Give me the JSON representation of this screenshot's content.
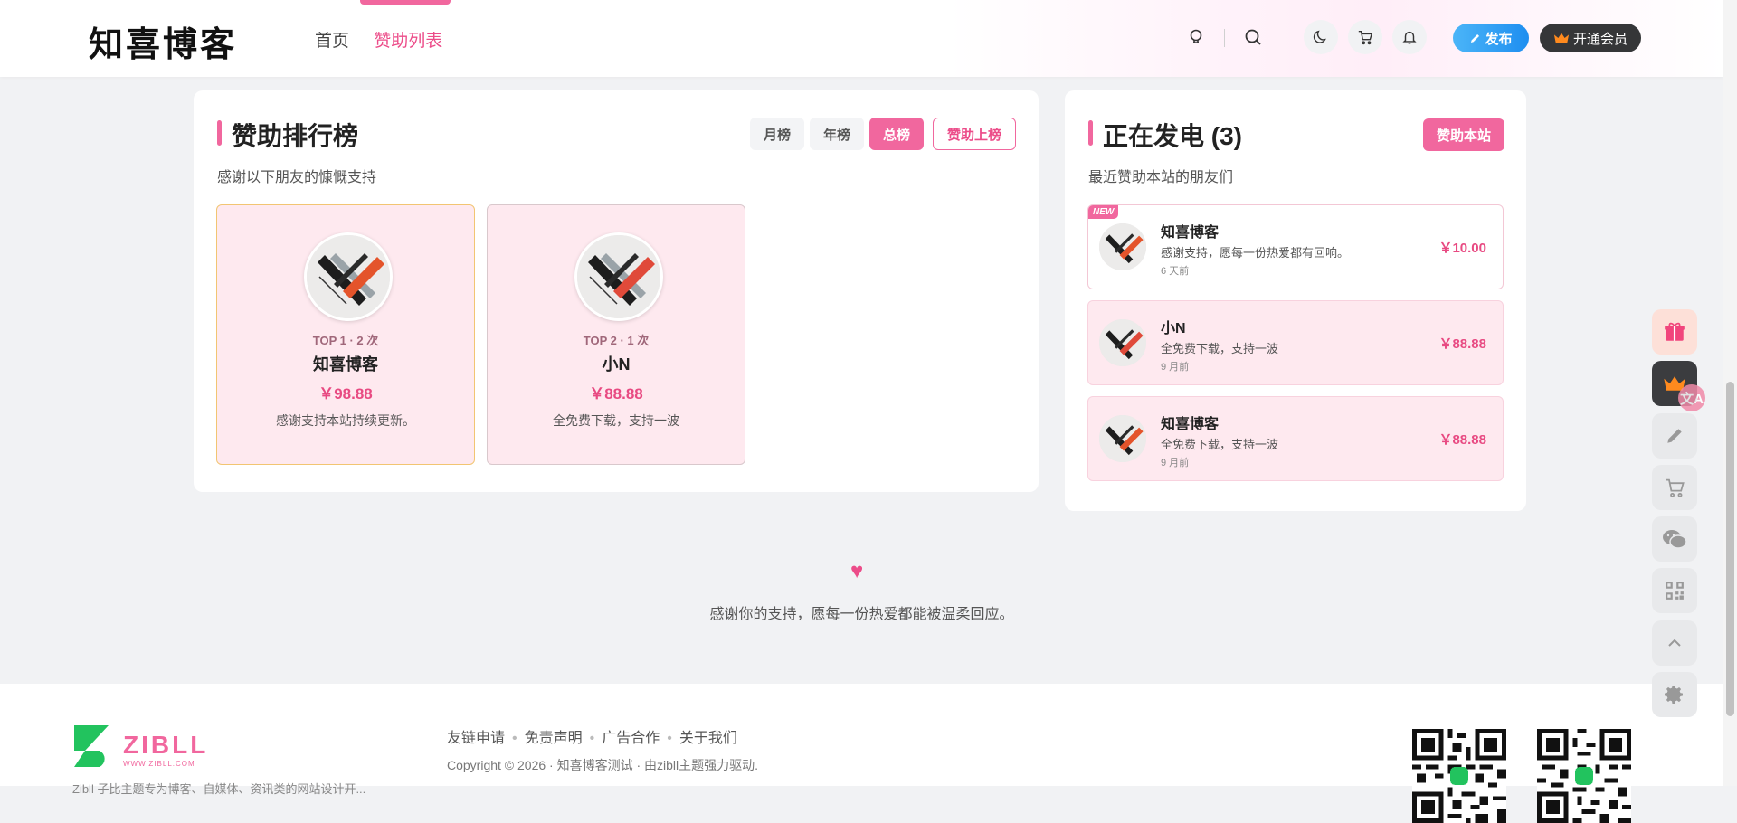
{
  "header": {
    "logo": "知喜博客",
    "nav": [
      {
        "label": "首页"
      },
      {
        "label": "赞助列表"
      }
    ],
    "publish_label": "发布",
    "vip_label": "开通会员",
    "icons": [
      "lightbulb-icon",
      "search-icon",
      "moon-icon",
      "cart-icon",
      "bell-icon"
    ]
  },
  "ranking": {
    "title": "赞助排行榜",
    "subtitle": "感谢以下朋友的慷慨支持",
    "tabs": [
      {
        "label": "月榜"
      },
      {
        "label": "年榜"
      },
      {
        "label": "总榜"
      }
    ],
    "active_tab": "总榜",
    "upload_label": "赞助上榜",
    "items": [
      {
        "rank": "TOP 1 · 2 次",
        "name": "知喜博客",
        "amount": "￥98.88",
        "message": "感谢支持本站持续更新。"
      },
      {
        "rank": "TOP 2 · 1 次",
        "name": "小N",
        "amount": "￥88.88",
        "message": "全免费下载，支持一波"
      }
    ]
  },
  "charging": {
    "title": "正在发电 (3)",
    "subtitle": "最近赞助本站的朋友们",
    "sponsor_label": "赞助本站",
    "new_badge": "NEW",
    "items": [
      {
        "name": "知喜博客",
        "message": "感谢支持，愿每一份热爱都有回响。",
        "time": "6 天前",
        "amount": "￥10.00"
      },
      {
        "name": "小N",
        "message": "全免费下载，支持一波",
        "time": "9 月前",
        "amount": "￥88.88"
      },
      {
        "name": "知喜博客",
        "message": "全免费下载，支持一波",
        "time": "9 月前",
        "amount": "￥88.88"
      }
    ]
  },
  "thanks": {
    "heart": "♥",
    "text": "感谢你的支持，愿每一份热爱都能被温柔回应。"
  },
  "footer": {
    "logo_text": "ZIBLL",
    "logo_sub": "WWW.ZIBLL.COM",
    "links": [
      {
        "label": "友链申请"
      },
      {
        "label": "免责声明"
      },
      {
        "label": "广告合作"
      },
      {
        "label": "关于我们"
      }
    ],
    "copyright": "Copyright © 2026 · 知喜博客测试 · 由zibll主题强力驱动.",
    "description": "Zibll 子比主题专为博客、自媒体、资讯类的网站设计开..."
  },
  "colors": {
    "accent": "#f1679e",
    "amount": "#e84a82",
    "blue": "#1e8ef0"
  }
}
